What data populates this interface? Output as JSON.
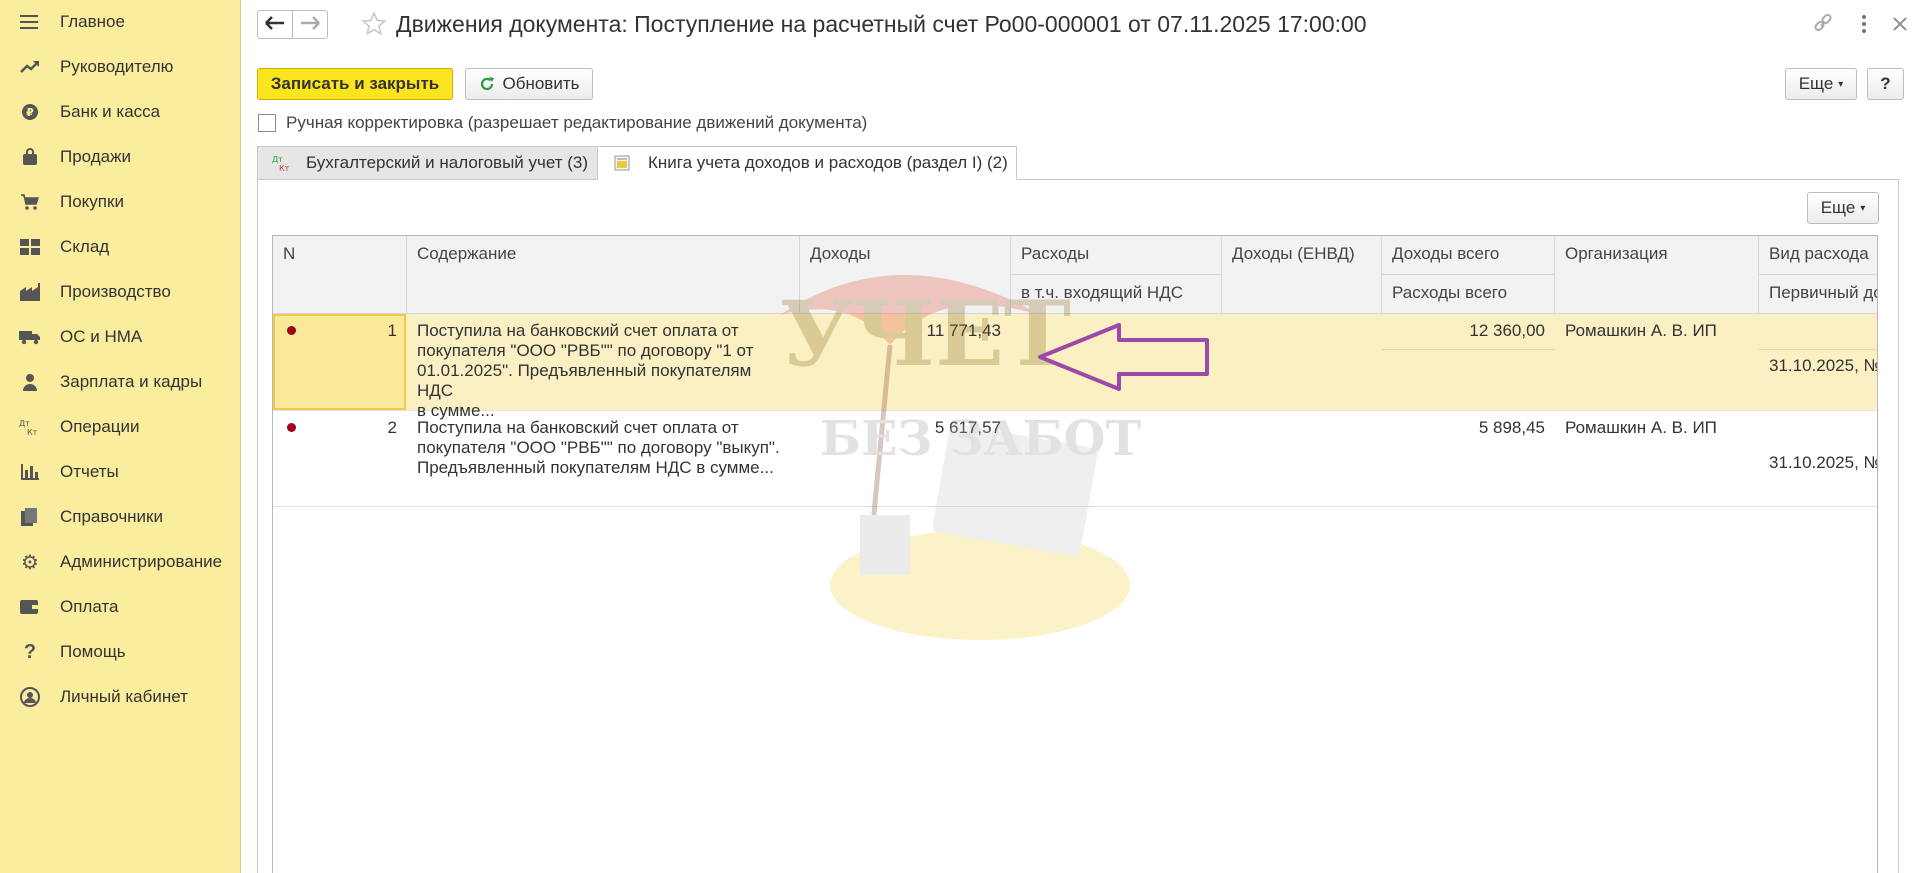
{
  "sidebar": {
    "items": [
      {
        "label": "Главное",
        "icon": "menu-icon"
      },
      {
        "label": "Руководителю",
        "icon": "trend-icon"
      },
      {
        "label": "Банк и касса",
        "icon": "ruble-icon"
      },
      {
        "label": "Продажи",
        "icon": "bag-icon"
      },
      {
        "label": "Покупки",
        "icon": "cart-icon"
      },
      {
        "label": "Склад",
        "icon": "warehouse-icon"
      },
      {
        "label": "Производство",
        "icon": "factory-icon"
      },
      {
        "label": "ОС и НМА",
        "icon": "truck-icon"
      },
      {
        "label": "Зарплата и кадры",
        "icon": "person-icon"
      },
      {
        "label": "Операции",
        "icon": "dt-kt-icon"
      },
      {
        "label": "Отчеты",
        "icon": "bar-chart-icon"
      },
      {
        "label": "Справочники",
        "icon": "books-icon"
      },
      {
        "label": "Администрирование",
        "icon": "gear-icon"
      },
      {
        "label": "Оплата",
        "icon": "wallet-icon"
      },
      {
        "label": "Помощь",
        "icon": "question-icon"
      },
      {
        "label": "Личный кабинет",
        "icon": "user-circle-icon"
      }
    ]
  },
  "header": {
    "title": "Движения документа: Поступление на расчетный счет Ро00-000001 от 07.11.2025 17:00:00"
  },
  "toolbar": {
    "save_close_label": "Записать и закрыть",
    "refresh_label": "Обновить",
    "more_label": "Еще",
    "help_label": "?"
  },
  "manual_correction": {
    "label": "Ручная корректировка (разрешает редактирование движений документа)",
    "checked": false
  },
  "tabs": [
    {
      "label": "Бухгалтерский и налоговый учет (3)",
      "active": false
    },
    {
      "label": "Книга учета доходов и расходов (раздел I) (2)",
      "active": true
    }
  ],
  "table": {
    "more_label": "Еще",
    "headers": {
      "n": "N",
      "content": "Содержание",
      "income": "Доходы",
      "expenses": "Расходы",
      "incl_vat": "в т.ч. входящий НДС",
      "income_envd": "Доходы (ЕНВД)",
      "income_total": "Доходы всего",
      "expenses_total": "Расходы всего",
      "organization": "Организация",
      "expense_type": "Вид расхода",
      "primary_doc": "Первичный до"
    },
    "rows": [
      {
        "n": "1",
        "content_lines": [
          "Поступила на банковский счет оплата от",
          "покупателя \"ООО \"РВБ\"\" по договору \"1 от",
          "01.01.2025\". Предъявленный покупателям НДС",
          "в сумме..."
        ],
        "income": "11 771,43",
        "income_total": "12 360,00",
        "organization": "Ромашкин А. В. ИП",
        "primary_doc": "31.10.2025, №"
      },
      {
        "n": "2",
        "content_lines": [
          "Поступила на банковский счет оплата от",
          "покупателя \"ООО \"РВБ\"\" по договору \"выкуп\".",
          "Предъявленный покупателям НДС в сумме..."
        ],
        "income": "5 617,57",
        "income_total": "5 898,45",
        "organization": "Ромашкин А. В. ИП",
        "primary_doc": "31.10.2025, №"
      }
    ]
  },
  "watermark": {
    "line1": "УЧЕТ",
    "line2": "БЕЗ ЗАБОТ"
  },
  "colors": {
    "sidebar_bg": "#fbed9e",
    "primary_button": "#fbe51e",
    "selected_row": "#faf0c4",
    "arrow": "#9b4aa8",
    "marker": "#a00016"
  }
}
